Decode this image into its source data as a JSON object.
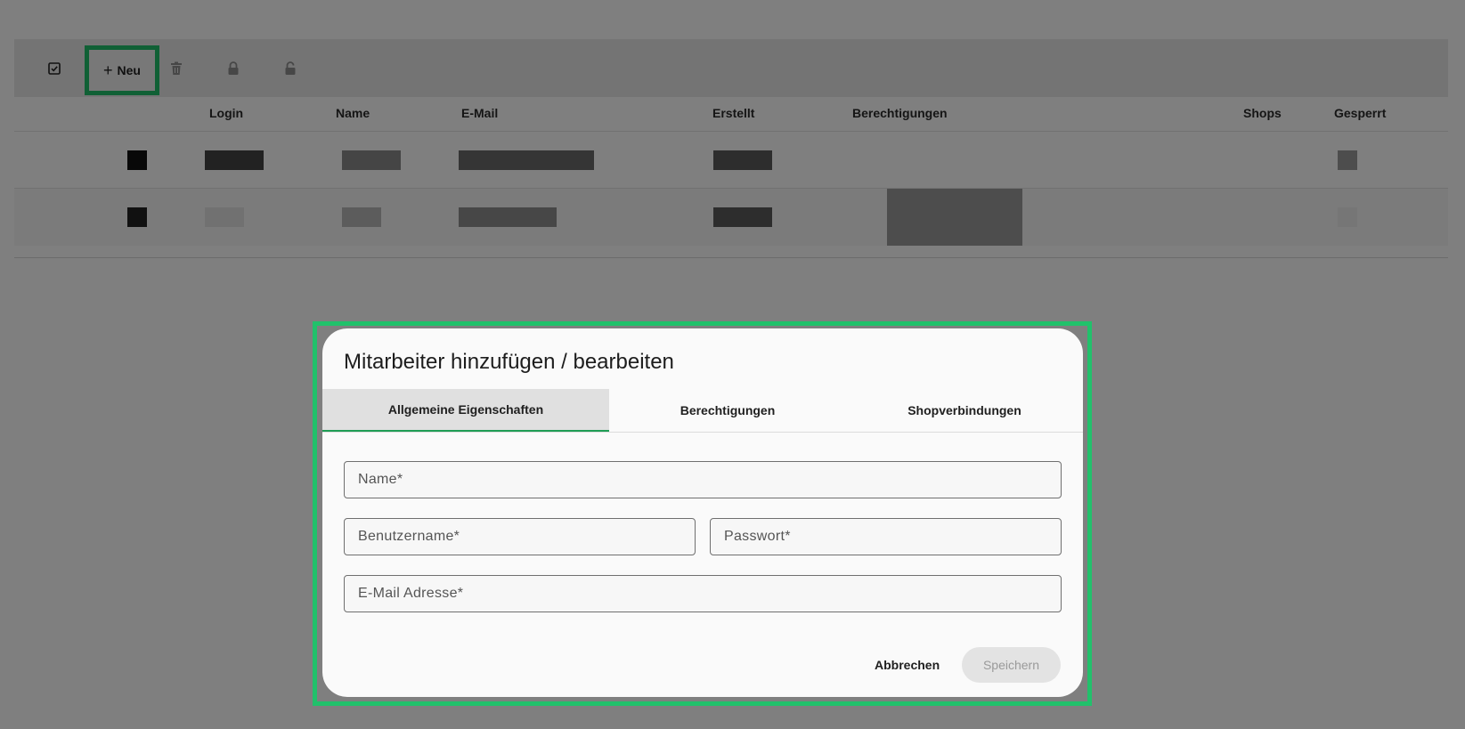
{
  "toolbar": {
    "select_all_icon": "checkbox-icon",
    "new_label": "Neu",
    "new_icon": "plus-icon",
    "delete_icon": "trash-icon",
    "lock_icon": "lock-icon",
    "unlock_icon": "unlock-icon"
  },
  "table": {
    "columns": [
      "Login",
      "Name",
      "E-Mail",
      "Erstellt",
      "Berechtigungen",
      "Shops",
      "Gesperrt"
    ]
  },
  "dialog": {
    "title": "Mitarbeiter hinzufügen / bearbeiten",
    "tabs": [
      "Allgemeine Eigenschaften",
      "Berechtigungen",
      "Shopverbindungen"
    ],
    "active_tab": "Allgemeine Eigenschaften",
    "fields": {
      "name_placeholder": "Name*",
      "username_placeholder": "Benutzername*",
      "password_placeholder": "Passwort*",
      "email_placeholder": "E-Mail Adresse*"
    },
    "cancel_label": "Abbrechen",
    "save_label": "Speichern"
  },
  "colors": {
    "highlight": "#21c16b",
    "active_tab_underline": "#1f9d55"
  }
}
